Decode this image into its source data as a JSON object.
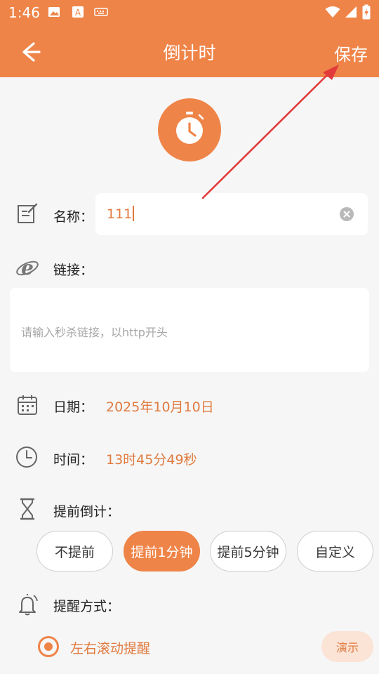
{
  "status_bar": {
    "time": "1:46"
  },
  "header": {
    "title": "倒计时",
    "save_label": "保存"
  },
  "form": {
    "name_label": "名称：",
    "name_value": "111",
    "link_label": "链接：",
    "link_placeholder": "请输入秒杀链接，以http开头",
    "date_label": "日期：",
    "date_value": "2025年10月10日",
    "time_label": "时间：",
    "time_value": "13时45分49秒",
    "advance_label": "提前倒计：",
    "advance_options": [
      "不提前",
      "提前1分钟",
      "提前5分钟",
      "自定义"
    ],
    "advance_selected": "提前1分钟",
    "reminder_label": "提醒方式：",
    "reminder_option": "左右滚动提醒",
    "demo_label": "演示"
  },
  "colors": {
    "accent": "#ef8448",
    "value_text": "#e07a3e",
    "annotation_arrow": "#e23b3b"
  },
  "icons": [
    "back-arrow-icon",
    "stopwatch-icon",
    "edit-note-icon",
    "ie-browser-icon",
    "calendar-icon",
    "clock-icon",
    "hourglass-icon",
    "bell-icon"
  ]
}
